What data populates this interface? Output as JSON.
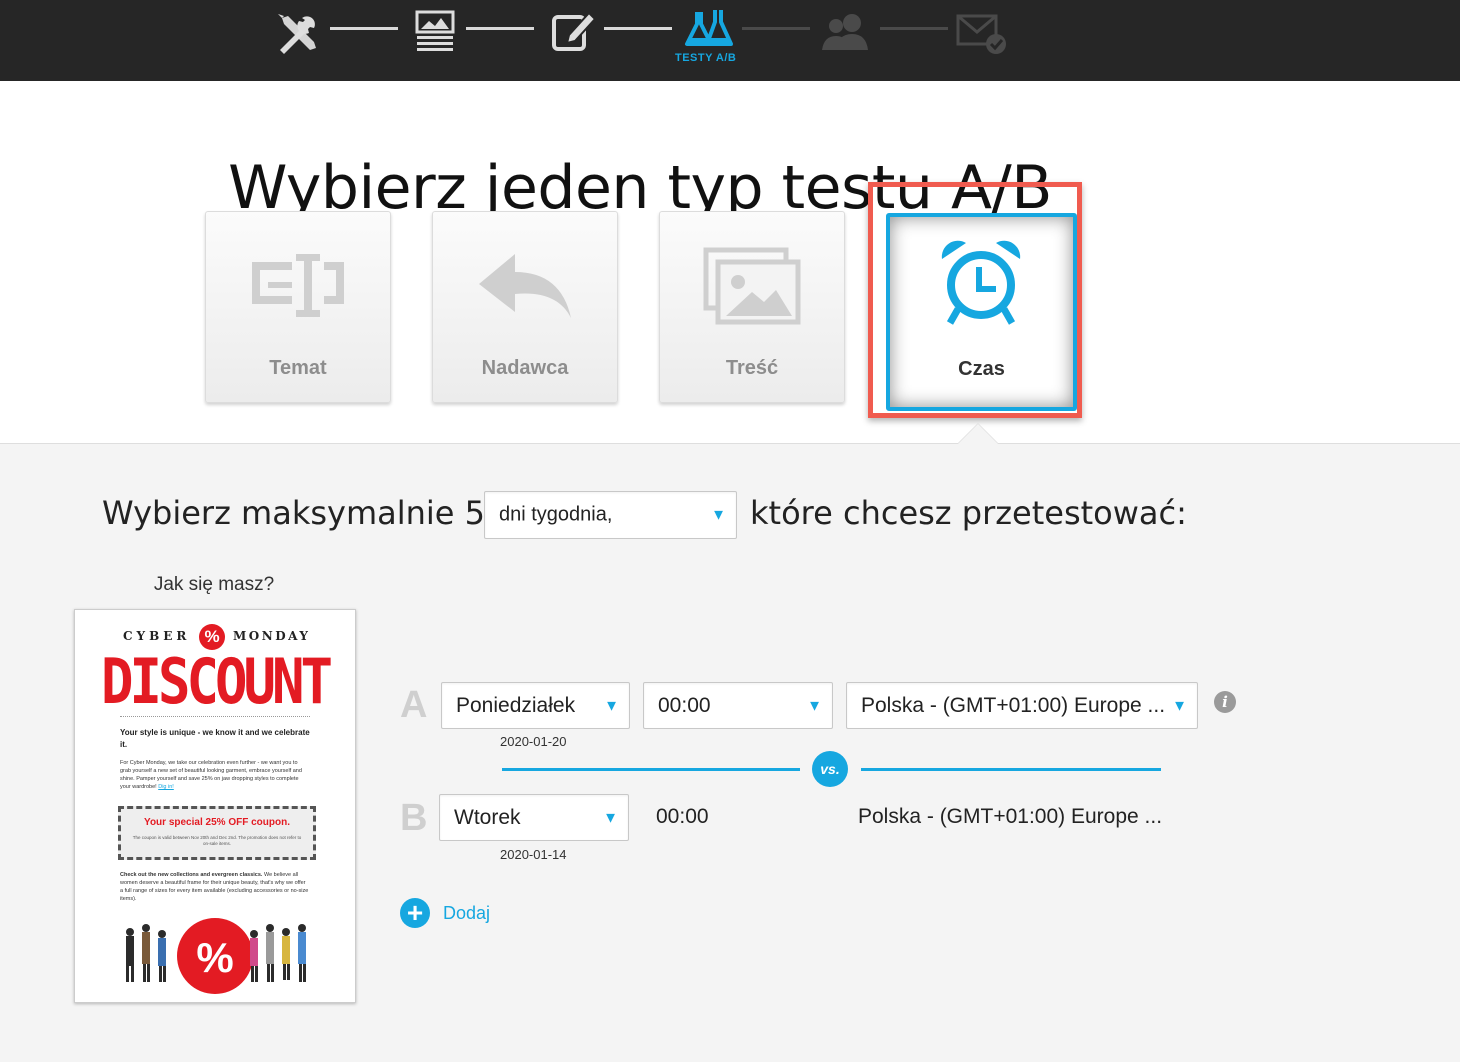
{
  "wizard": {
    "steps": [
      {
        "name": "settings",
        "icon": "tools-icon",
        "state": "done"
      },
      {
        "name": "template",
        "icon": "template-icon",
        "state": "done"
      },
      {
        "name": "edit",
        "icon": "edit-icon",
        "state": "done"
      },
      {
        "name": "ab-test",
        "icon": "flask-icon",
        "state": "active",
        "label": "TESTY A/B"
      },
      {
        "name": "recipients",
        "icon": "users-icon",
        "state": "pending"
      },
      {
        "name": "send",
        "icon": "envelope-check-icon",
        "state": "pending"
      }
    ],
    "active_label": "TESTY A/B"
  },
  "page": {
    "title": "Wybierz jeden typ testu A/B"
  },
  "test_types": {
    "subject": "Temat",
    "sender": "Nadawca",
    "content": "Treść",
    "time": "Czas",
    "selected": "Czas"
  },
  "question": {
    "prefix": "Wybierz maksymalnie 5",
    "dropdown_value": "dni tygodnia,",
    "suffix": "które chcesz przetestować:"
  },
  "preview": {
    "title": "Jak się masz?",
    "email": {
      "header_left": "CYBER",
      "header_right": "MONDAY",
      "headline": "DISCOUNT",
      "intro_bold": "Your style is unique - we know it and we celebrate it.",
      "body": "For Cyber Monday, we take our celebration even further - we want you to grab yourself a new set of beautiful looking garment, embrace yourself and shine. Pamper yourself and save 25% on jaw dropping styles to complete your wardrobe!",
      "dig_in": "Dig in!",
      "coupon_title": "Your special 25% OFF coupon.",
      "coupon_note": "The coupon is valid between Nov 20th and Dec 2nd. The promotion does not refer to on-sale items.",
      "collection_bold": "Check out the new collections and evergreen classics.",
      "collection_text": "We believe all women deserve a beautiful frame for their unique beauty, that's why we offer a full range of sizes for every item available (excluding accessories or no-size items)."
    }
  },
  "variants": [
    {
      "letter": "A",
      "day": "Poniedziałek",
      "date": "2020-01-20",
      "time": "00:00",
      "timezone": "Polska - (GMT+01:00) Europe ..."
    },
    {
      "letter": "B",
      "day": "Wtorek",
      "date": "2020-01-14",
      "time": "00:00",
      "timezone": "Polska - (GMT+01:00) Europe ..."
    }
  ],
  "vs_label": "vs.",
  "info_icon": "i",
  "add": {
    "label": "Dodaj",
    "icon": "plus-circle-icon"
  },
  "colors": {
    "accent": "#16a7e0",
    "highlight": "#f05b4f",
    "topbar": "#262626"
  }
}
